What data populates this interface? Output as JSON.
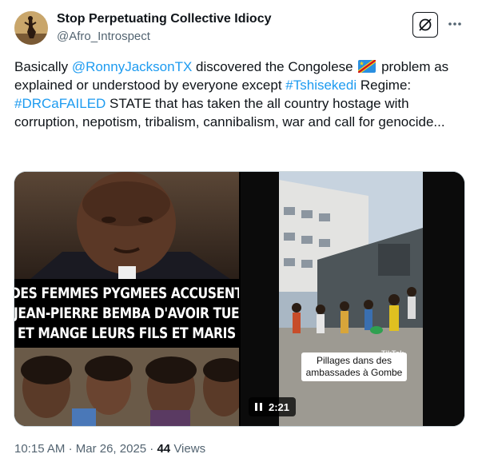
{
  "author": {
    "name": "Stop Perpetuating Collective Idiocy",
    "handle": "@Afro_Introspect"
  },
  "tweet": {
    "t1": "Basically ",
    "mention": "@RonnyJacksonTX",
    "t2": "  discovered the Congolese ",
    "t3": " problem as explained or understood by everyone except ",
    "hashtag1": "#Tshisekedi",
    "t4": " Regime: ",
    "hashtag2": "#DRCaFAILED",
    "t5": " STATE that has taken the all country hostage with corruption, nepotism, tribalism, cannibalism, war and call for genocide..."
  },
  "media": {
    "left": {
      "headline": [
        "DES FEMMES PYGMEES ACCUSENT",
        "JEAN-PIERRE BEMBA D'AVOIR TUE",
        "ET MANGE LEURS FILS ET MARIS"
      ]
    },
    "right": {
      "caption": "Pillages dans des ambassades à Gombe",
      "watermark": "TikTok",
      "duration": "2:21"
    }
  },
  "meta": {
    "time": "10:15 AM",
    "date": "Mar 26, 2025",
    "views_count": "44",
    "views_label": "Views"
  },
  "colors": {
    "link": "#1d9bf0",
    "secondary_text": "#536471"
  },
  "icons": [
    "grok-icon",
    "more-icon",
    "pause-icon",
    "drc-flag-emoji"
  ]
}
